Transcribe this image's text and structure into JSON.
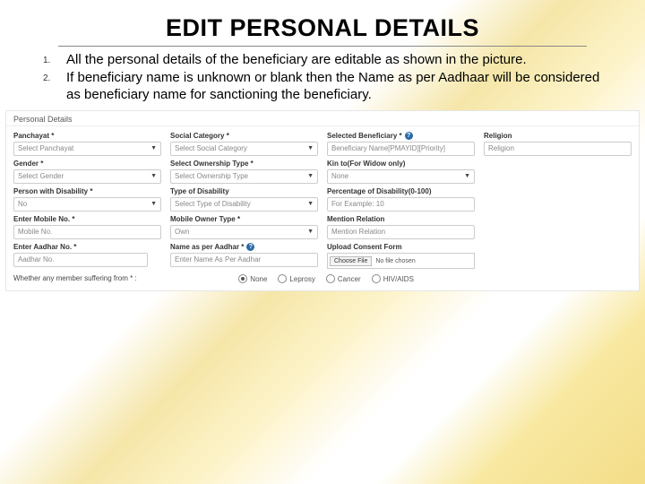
{
  "title": "EDIT PERSONAL DETAILS",
  "list": [
    "All the personal details of the beneficiary are editable as shown in the picture.",
    "If beneficiary name is unknown or blank  then the Name as per Aadhaar will be considered as beneficiary name for sanctioning the beneficiary."
  ],
  "form": {
    "header": "Personal Details",
    "row1": {
      "c1": {
        "label": "Panchayat *",
        "ph": "Select Panchayat"
      },
      "c2": {
        "label": "Social Category *",
        "ph": "Select Social Category"
      },
      "c3": {
        "label": "Selected Beneficiary *",
        "ph": "Beneficiary Name[PMAYID][Priority]"
      },
      "c4": {
        "label": "Religion",
        "ph": "Religion"
      }
    },
    "row2": {
      "c1": {
        "label": "Gender *",
        "ph": "Select Gender"
      },
      "c2": {
        "label": "Select Ownership Type *",
        "ph": "Select Ownership Type"
      },
      "c3": {
        "label": "Kin to(For Widow only)",
        "ph": "None"
      }
    },
    "row3": {
      "c1": {
        "label": "Person with Disability *",
        "ph": "No"
      },
      "c2": {
        "label": "Type of Disability",
        "ph": "Select Type of Disability"
      },
      "c3": {
        "label": "Percentage of Disability(0-100)",
        "ph": "For Example: 10"
      }
    },
    "row4": {
      "c1": {
        "label": "Enter Mobile No. *",
        "ph": "Mobile No."
      },
      "c2": {
        "label": "Mobile Owner Type *",
        "ph": "Own"
      },
      "c3": {
        "label": "Mention Relation",
        "ph": "Mention Relation"
      }
    },
    "row5": {
      "c1": {
        "label": "Enter Aadhar No. *",
        "ph": "Aadhar No."
      },
      "c2": {
        "label": "Name as per Aadhar *",
        "ph": "Enter Name As Per Aadhar"
      },
      "c3": {
        "label": "Upload Consent Form",
        "btn": "Choose File",
        "file_text": "No file chosen"
      }
    },
    "row6": {
      "label": "Whether any member suffering from * :",
      "options": [
        "None",
        "Leprosy",
        "Cancer",
        "HIV/AIDS"
      ]
    }
  }
}
